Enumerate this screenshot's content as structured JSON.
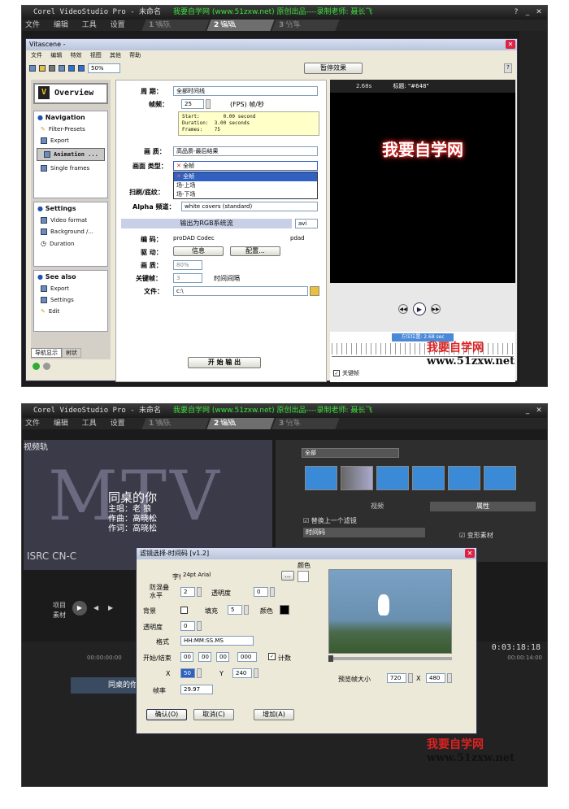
{
  "app_title": "Corel VideoStudio Pro - 未命名",
  "banner": "我要自学网 (www.51zxw.net) 原创出品----录制老师: 聂长飞",
  "menu": [
    "文件",
    "编辑",
    "工具",
    "设置"
  ],
  "steps": [
    {
      "num": "1",
      "label": "捕获"
    },
    {
      "num": "2",
      "label": "编辑"
    },
    {
      "num": "3",
      "label": "分享"
    }
  ],
  "vita": {
    "title": "Vitascene -",
    "menu": [
      "文件",
      "编辑",
      "特效",
      "视图",
      "其他",
      "帮助"
    ],
    "zoom": "50%",
    "pause_btn": "暂停效果",
    "overview": "Overview",
    "nav": {
      "title": "Navigation",
      "items": [
        "Filter-Presets",
        "Export",
        "Animation ...",
        "Single frames"
      ]
    },
    "settings": {
      "title": "Settings",
      "items": [
        "Video format",
        "Background /...",
        "Duration"
      ]
    },
    "seealso": {
      "title": "See also",
      "items": [
        "Export",
        "Settings",
        "Edit"
      ]
    },
    "tabs": [
      "导航显示",
      "树状"
    ],
    "period_label": "周 期：",
    "period_value": "全部时间线",
    "fps_label": "帧频：",
    "fps_value": "25",
    "fps_unit": "(FPS) 帧/秒",
    "info": "Start:        0.00 second\nDuration:  3.00 seconds\nFrames:    75",
    "quality_label": "画 质：",
    "quality_value": "高品质-最后结果",
    "frametype_label": "画面 类型：",
    "frametype_value": "全帧",
    "frametype_options": [
      "全帧",
      "场-上场",
      "场-下场"
    ],
    "interlace_label": "扫刷/底纹：",
    "alpha_label": "Alpha 频道：",
    "alpha_value": "white covers (standard)",
    "rgb_label": "输出为RGB系统流",
    "rgb_value": "avi",
    "codec_label": "编 码：",
    "codec_value": "proDAD Codec",
    "codec_ext": "pdad",
    "driver_label": "驱 动：",
    "info_btn": "信息",
    "config_btn": "配置...",
    "quality2_label": "画 质：",
    "quality2_value": "80%",
    "keyframe_label": "关键帧：",
    "keyframe_value": "3",
    "keyframe_unit": "时间间隔",
    "file_label": "文件：",
    "file_value": "c:\\",
    "start_btn": "开 始 输 出",
    "preview_time": "2.68s",
    "preview_name": "标题: \"#648\"",
    "preview_text": "我要自学网",
    "position": "方位位置: 2.68 sec",
    "keyframe_chk": "关键帧"
  },
  "vs2": {
    "track_label": "视频轨",
    "mtv_title": "同桌的你",
    "mtv_credits": [
      "主唱：老 狼",
      "作曲：高晓松",
      "作词：高晓松"
    ],
    "mtv_isrc": "ISRC CN-C",
    "library_sel": "全部",
    "tabs": [
      "视频",
      "属性"
    ],
    "replace_filter": "替换上一个滤镜",
    "filter_item": "时间码",
    "deform": "变形素材",
    "project_label": "项目",
    "material_label": "素材",
    "timecode": "0:03:18:18",
    "clip_label": "同桌的你",
    "ruler_start": "00:00:00:00",
    "ruler_end": "00:00:14:00"
  },
  "filter_dlg": {
    "title": "滤镜选择-时间码 [v1.2]",
    "font_label": "字体",
    "font_value": "24pt Arial",
    "font_btn": "...",
    "color_label": "颜色",
    "aa_label": "防混叠水平",
    "aa_value": "2",
    "trans_label": "透明度",
    "trans_value": "0",
    "bg_label": "背景",
    "fill_label": "填充",
    "fill_value": "5",
    "bgcolor_label": "颜色",
    "trans2_label": "透明度",
    "trans2_value": "0",
    "format_label": "格式",
    "format_value": "HH:MM:SS.MS",
    "startend_label": "开始/结束",
    "t1": "00",
    "t2": "00",
    "t3": "00",
    "t4": "000",
    "count_label": "计数",
    "x_label": "X",
    "x_value": "50",
    "y_label": "Y",
    "y_value": "240",
    "fps_label": "帧率",
    "fps_value": "29.97",
    "preview_size_label": "预览帧大小",
    "pw": "720",
    "ph": "480",
    "px": "X",
    "ok": "确认(O)",
    "cancel": "取消(C)",
    "add": "增加(A)"
  },
  "watermark": {
    "text": "我要自学网",
    "url": "www.51zxw.net"
  },
  "colors": {
    "accent": "#3ce03c",
    "watermark": "#d22222",
    "preview_glow": "#ff3030"
  }
}
